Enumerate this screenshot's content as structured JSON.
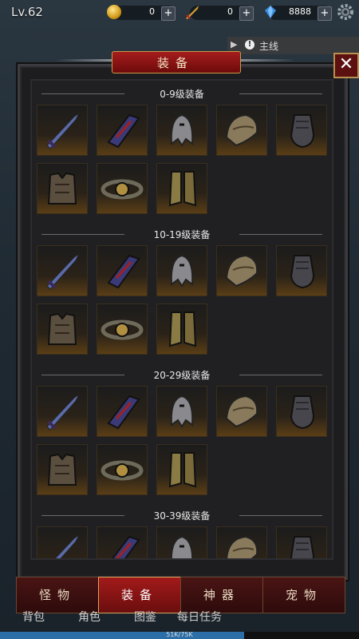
{
  "hud": {
    "level": "Lv.62",
    "gold": "0",
    "power": "0",
    "gems": "8888",
    "plus": "+"
  },
  "quest": {
    "label": "主线",
    "info": "!"
  },
  "panel": {
    "title": "装备",
    "close": "✕",
    "sections": [
      {
        "title": "0-9级装备",
        "items": [
          "sword",
          "shield",
          "helmet",
          "shoulder",
          "gloves",
          "armor",
          "belt",
          "boots"
        ]
      },
      {
        "title": "10-19级装备",
        "items": [
          "sword",
          "shield",
          "helmet",
          "shoulder",
          "gloves",
          "armor",
          "belt",
          "boots"
        ]
      },
      {
        "title": "20-29级装备",
        "items": [
          "sword",
          "shield",
          "helmet",
          "shoulder",
          "gloves",
          "armor",
          "belt",
          "boots"
        ]
      },
      {
        "title": "30-39级装备",
        "items": [
          "sword",
          "shield",
          "helmet",
          "shoulder",
          "gloves"
        ]
      }
    ]
  },
  "tabs": [
    {
      "label": "怪物",
      "active": false
    },
    {
      "label": "装备",
      "active": true
    },
    {
      "label": "神器",
      "active": false
    },
    {
      "label": "宠物",
      "active": false
    }
  ],
  "bottom_nav": [
    "背包",
    "角色",
    "图鉴",
    "每日任务"
  ],
  "xp": {
    "text": "51K/75K",
    "progress": 0.68
  },
  "colors": {
    "accent": "#a31a1a",
    "gold_border": "#c79a4a",
    "panel_bg": "#202022",
    "xp_fill": "#2b6ea8"
  }
}
